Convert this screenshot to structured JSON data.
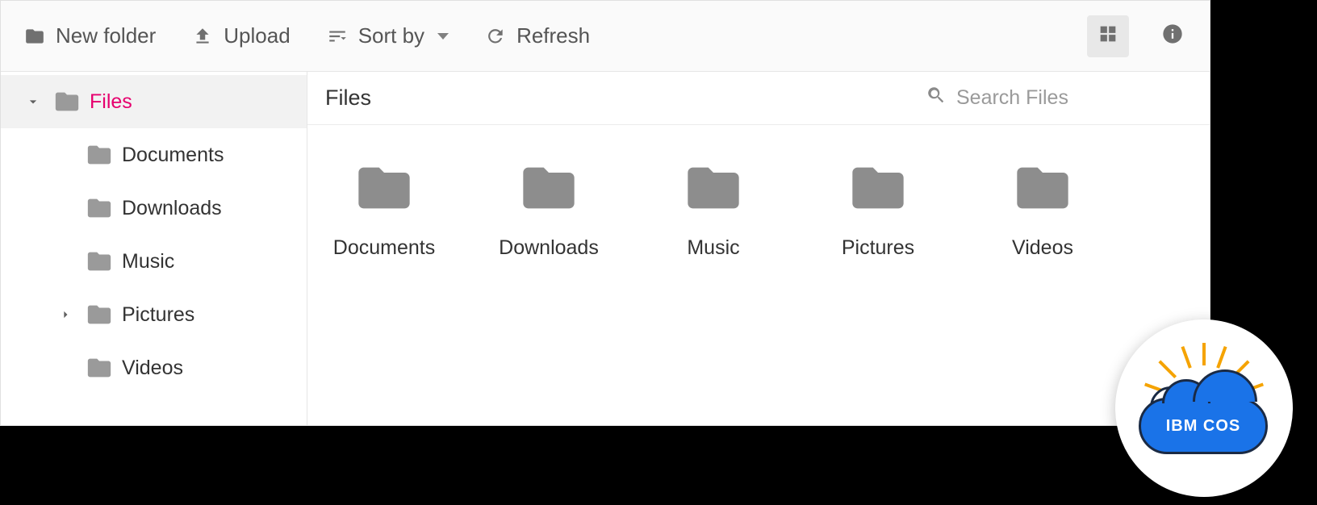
{
  "toolbar": {
    "new_folder_label": "New folder",
    "upload_label": "Upload",
    "sort_by_label": "Sort by",
    "refresh_label": "Refresh"
  },
  "sidebar": {
    "root_label": "Files",
    "items": [
      {
        "label": "Documents",
        "expandable": false
      },
      {
        "label": "Downloads",
        "expandable": false
      },
      {
        "label": "Music",
        "expandable": false
      },
      {
        "label": "Pictures",
        "expandable": true
      },
      {
        "label": "Videos",
        "expandable": false
      }
    ]
  },
  "main": {
    "title": "Files",
    "search_placeholder": "Search Files",
    "folders": [
      {
        "label": "Documents"
      },
      {
        "label": "Downloads"
      },
      {
        "label": "Music"
      },
      {
        "label": "Pictures"
      },
      {
        "label": "Videos"
      }
    ]
  },
  "badge": {
    "text": "IBM COS"
  }
}
